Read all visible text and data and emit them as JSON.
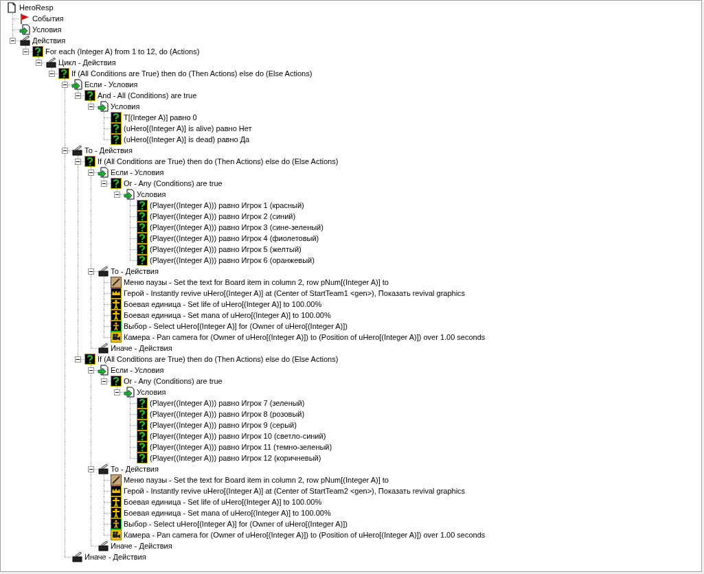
{
  "tree": {
    "kind": "document",
    "label": "HeroResp",
    "children": [
      {
        "kind": "flag",
        "label": "События"
      },
      {
        "kind": "condition",
        "label": "Условия"
      },
      {
        "kind": "actions",
        "label": "Действия",
        "expanded": true,
        "children": [
          {
            "kind": "question",
            "label": "For each (Integer A) from 1 to 12, do (Actions)",
            "expanded": true,
            "children": [
              {
                "kind": "actions",
                "label": "Цикл - Действия",
                "expanded": true,
                "children": [
                  {
                    "kind": "question",
                    "label": "If (All Conditions are True) then do (Then Actions) else do (Else Actions)",
                    "expanded": true,
                    "children": [
                      {
                        "kind": "condition",
                        "label": "Если - Условия",
                        "expanded": true,
                        "children": [
                          {
                            "kind": "question",
                            "label": "And - All (Conditions) are true",
                            "expanded": true,
                            "children": [
                              {
                                "kind": "condition",
                                "label": "Условия",
                                "expanded": true,
                                "children": [
                                  {
                                    "kind": "question",
                                    "label": "T[(Integer A)] равно 0"
                                  },
                                  {
                                    "kind": "question",
                                    "label": "(uHero[(Integer A)] is alive) равно Нет"
                                  },
                                  {
                                    "kind": "question",
                                    "label": "(uHero[(Integer A)] is dead) равно Да"
                                  }
                                ]
                              }
                            ]
                          }
                        ]
                      },
                      {
                        "kind": "actions",
                        "label": "То - Действия",
                        "expanded": true,
                        "children": [
                          {
                            "kind": "question",
                            "label": "If (All Conditions are True) then do (Then Actions) else do (Else Actions)",
                            "expanded": true,
                            "children": [
                              {
                                "kind": "condition",
                                "label": "Если - Условия",
                                "expanded": true,
                                "children": [
                                  {
                                    "kind": "question",
                                    "label": "Or - Any (Conditions) are true",
                                    "expanded": true,
                                    "children": [
                                      {
                                        "kind": "condition",
                                        "label": "Условия",
                                        "expanded": true,
                                        "children": [
                                          {
                                            "kind": "question",
                                            "label": "(Player((Integer A))) равно Игрок 1 (красный)"
                                          },
                                          {
                                            "kind": "question",
                                            "label": "(Player((Integer A))) равно Игрок 2 (синий)"
                                          },
                                          {
                                            "kind": "question",
                                            "label": "(Player((Integer A))) равно Игрок 3 (сине-зеленый)"
                                          },
                                          {
                                            "kind": "question",
                                            "label": "(Player((Integer A))) равно Игрок 4 (фиолетовый)"
                                          },
                                          {
                                            "kind": "question",
                                            "label": "(Player((Integer A))) равно Игрок 5 (желтый)"
                                          },
                                          {
                                            "kind": "question",
                                            "label": "(Player((Integer A))) равно Игрок 6 (оранжевый)"
                                          }
                                        ]
                                      }
                                    ]
                                  }
                                ]
                              },
                              {
                                "kind": "actions",
                                "label": "То - Действия",
                                "expanded": true,
                                "children": [
                                  {
                                    "kind": "pencil",
                                    "label": "Меню паузы - Set the text for Board item in column 2, row pNum[(Integer A)] to"
                                  },
                                  {
                                    "kind": "crown",
                                    "label": "Герой - Instantly revive uHero[(Integer A)] at (Center of StartTeam1 <gen>), Показать revival graphics"
                                  },
                                  {
                                    "kind": "unit",
                                    "label": "Боевая единица - Set life of uHero[(Integer A)] to 100.00%"
                                  },
                                  {
                                    "kind": "unit",
                                    "label": "Боевая единица - Set mana of uHero[(Integer A)] to 100.00%"
                                  },
                                  {
                                    "kind": "selection",
                                    "label": "Выбор - Select uHero[(Integer A)] for (Owner of uHero[(Integer A)])"
                                  },
                                  {
                                    "kind": "camera",
                                    "label": "Камера - Pan camera for (Owner of uHero[(Integer A)]) to (Position of uHero[(Integer A)]) over 1.00 seconds"
                                  }
                                ]
                              },
                              {
                                "kind": "actions",
                                "label": "Иначе - Действия"
                              }
                            ]
                          },
                          {
                            "kind": "question",
                            "label": "If (All Conditions are True) then do (Then Actions) else do (Else Actions)",
                            "expanded": true,
                            "children": [
                              {
                                "kind": "condition",
                                "label": "Если - Условия",
                                "expanded": true,
                                "children": [
                                  {
                                    "kind": "question",
                                    "label": "Or - Any (Conditions) are true",
                                    "expanded": true,
                                    "children": [
                                      {
                                        "kind": "condition",
                                        "label": "Условия",
                                        "expanded": true,
                                        "children": [
                                          {
                                            "kind": "question",
                                            "label": "(Player((Integer A))) равно Игрок 7 (зеленый)"
                                          },
                                          {
                                            "kind": "question",
                                            "label": "(Player((Integer A))) равно Игрок 8 (розовый)"
                                          },
                                          {
                                            "kind": "question",
                                            "label": "(Player((Integer A))) равно Игрок 9 (серый)"
                                          },
                                          {
                                            "kind": "question",
                                            "label": "(Player((Integer A))) равно Игрок 10 (светло-синий)"
                                          },
                                          {
                                            "kind": "question",
                                            "label": "(Player((Integer A))) равно Игрок 11 (темно-зеленый)"
                                          },
                                          {
                                            "kind": "question",
                                            "label": "(Player((Integer A))) равно Игрок 12 (коричневый)"
                                          }
                                        ]
                                      }
                                    ]
                                  }
                                ]
                              },
                              {
                                "kind": "actions",
                                "label": "То - Действия",
                                "expanded": true,
                                "children": [
                                  {
                                    "kind": "pencil",
                                    "label": "Меню паузы - Set the text for Board item in column 2, row pNum[(Integer A)] to"
                                  },
                                  {
                                    "kind": "crown",
                                    "label": "Герой - Instantly revive uHero[(Integer A)] at (Center of StartTeam2 <gen>), Показать revival graphics"
                                  },
                                  {
                                    "kind": "unit",
                                    "label": "Боевая единица - Set life of uHero[(Integer A)] to 100.00%"
                                  },
                                  {
                                    "kind": "unit",
                                    "label": "Боевая единица - Set mana of uHero[(Integer A)] to 100.00%"
                                  },
                                  {
                                    "kind": "selection",
                                    "label": "Выбор - Select uHero[(Integer A)] for (Owner of uHero[(Integer A)])"
                                  },
                                  {
                                    "kind": "camera",
                                    "label": "Камера - Pan camera for (Owner of uHero[(Integer A)]) to (Position of uHero[(Integer A)]) over 1.00 seconds"
                                  }
                                ]
                              },
                              {
                                "kind": "actions",
                                "label": "Иначе - Действия"
                              }
                            ]
                          }
                        ]
                      },
                      {
                        "kind": "actions",
                        "label": "Иначе - Действия"
                      }
                    ]
                  }
                ]
              }
            ]
          }
        ]
      }
    ]
  }
}
